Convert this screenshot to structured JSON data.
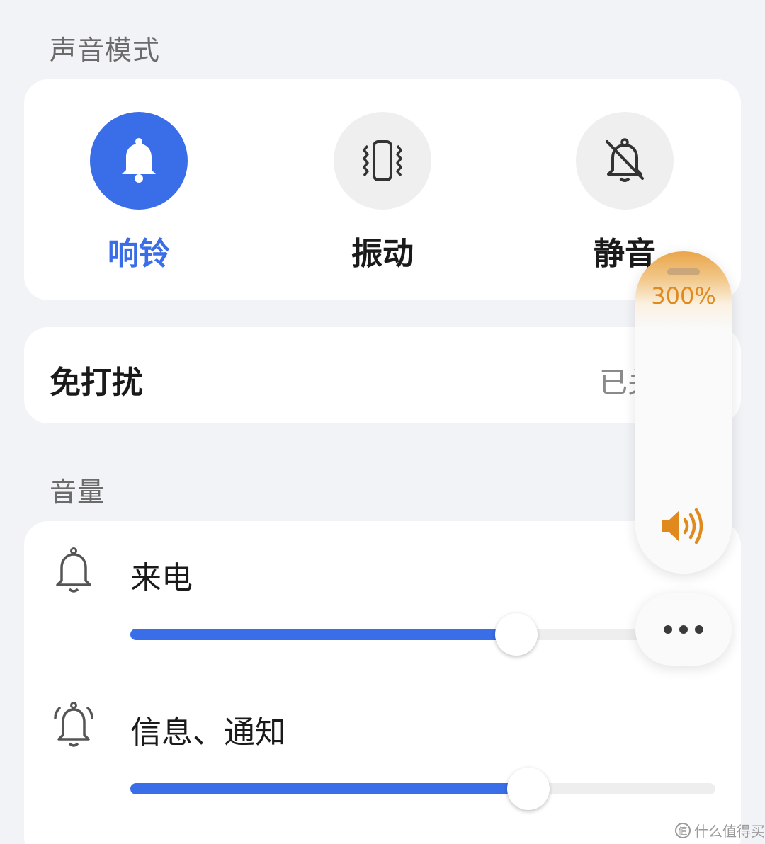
{
  "sound_mode": {
    "title": "声音模式",
    "options": [
      {
        "label": "响铃",
        "icon": "bell-icon",
        "active": true
      },
      {
        "label": "振动",
        "icon": "vibrate-icon",
        "active": false
      },
      {
        "label": "静音",
        "icon": "bell-off-icon",
        "active": false
      }
    ]
  },
  "dnd": {
    "label": "免打扰",
    "status": "已关"
  },
  "volume": {
    "title": "音量",
    "items": [
      {
        "label": "来电",
        "icon": "bell-icon",
        "level": 0.66
      },
      {
        "label": "信息、通知",
        "icon": "bell-ringing-icon",
        "level": 0.68
      }
    ]
  },
  "volume_panel": {
    "percent": "300%",
    "icon": "speaker-icon",
    "accent": "#e08a1e"
  },
  "more_button": {
    "icon": "more-icon"
  },
  "watermark": {
    "text": "什么值得买"
  },
  "colors": {
    "accent": "#3a6ee8",
    "background": "#f1f3f6"
  }
}
